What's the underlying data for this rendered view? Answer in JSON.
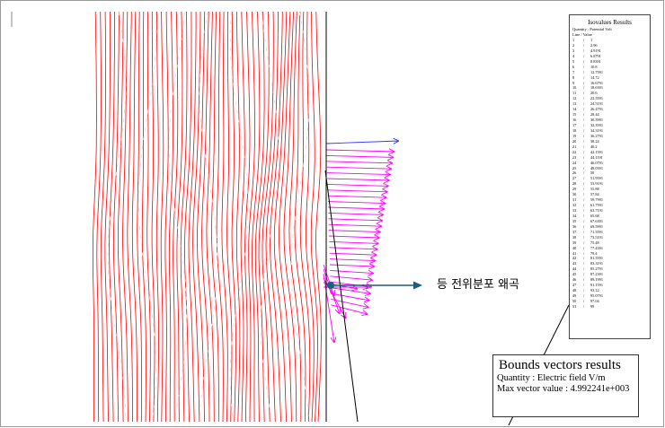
{
  "legend": {
    "title": "Isovalues Results",
    "quantity": "Quantity : Potential Volt",
    "header": "Line / Value",
    "rows": [
      [
        "1",
        "1"
      ],
      [
        "2",
        "2.96"
      ],
      [
        "3",
        "4.9191"
      ],
      [
        "4",
        "6.8791"
      ],
      [
        "5",
        "8.8391"
      ],
      [
        "6",
        "10.8"
      ],
      [
        "7",
        "12.7591"
      ],
      [
        "8",
        "14.72"
      ],
      [
        "9",
        "16.6791"
      ],
      [
        "10",
        "18.6391"
      ],
      [
        "11",
        "20.6"
      ],
      [
        "12",
        "22.5591"
      ],
      [
        "13",
        "24.5191"
      ],
      [
        "14",
        "26.4791"
      ],
      [
        "15",
        "28.44"
      ],
      [
        "16",
        "30.3991"
      ],
      [
        "17",
        "32.3591"
      ],
      [
        "18",
        "34.3191"
      ],
      [
        "19",
        "36.2791"
      ],
      [
        "20",
        "38.24"
      ],
      [
        "21",
        "40.2"
      ],
      [
        "22",
        "42.1591"
      ],
      [
        "23",
        "44.1191"
      ],
      [
        "24",
        "46.0791"
      ],
      [
        "25",
        "48.0391"
      ],
      [
        "26",
        "50"
      ],
      [
        "27",
        "51.9591"
      ],
      [
        "28",
        "53.9191"
      ],
      [
        "29",
        "55.88"
      ],
      [
        "30",
        "57.84"
      ],
      [
        "31",
        "59.7991"
      ],
      [
        "32",
        "61.7591"
      ],
      [
        "33",
        "63.7191"
      ],
      [
        "34",
        "65.68"
      ],
      [
        "35",
        "67.6391"
      ],
      [
        "36",
        "69.5991"
      ],
      [
        "37",
        "71.5591"
      ],
      [
        "38",
        "73.5191"
      ],
      [
        "39",
        "75.48"
      ],
      [
        "40",
        "77.4391"
      ],
      [
        "41",
        "79.4"
      ],
      [
        "42",
        "81.3591"
      ],
      [
        "43",
        "83.3191"
      ],
      [
        "44",
        "85.2791"
      ],
      [
        "45",
        "87.2391"
      ],
      [
        "46",
        "89.1991"
      ],
      [
        "47",
        "91.1591"
      ],
      [
        "48",
        "93.12"
      ],
      [
        "49",
        "95.0791"
      ],
      [
        "50",
        "97.04"
      ],
      [
        "51",
        "99"
      ]
    ]
  },
  "bounds": {
    "title": "Bounds vectors results",
    "quantity": "Quantity : Electric field V/m",
    "max_vector": "Max vector value : 4.992241e+003"
  },
  "annotation": {
    "text": "등 전위분포 왜곡"
  },
  "colors": {
    "isoline": "#ff0000",
    "vector": "#ff00ff",
    "vector_max": "#3333ff",
    "marker": "#0a6a7a",
    "arrow": "#1b5e7a"
  }
}
